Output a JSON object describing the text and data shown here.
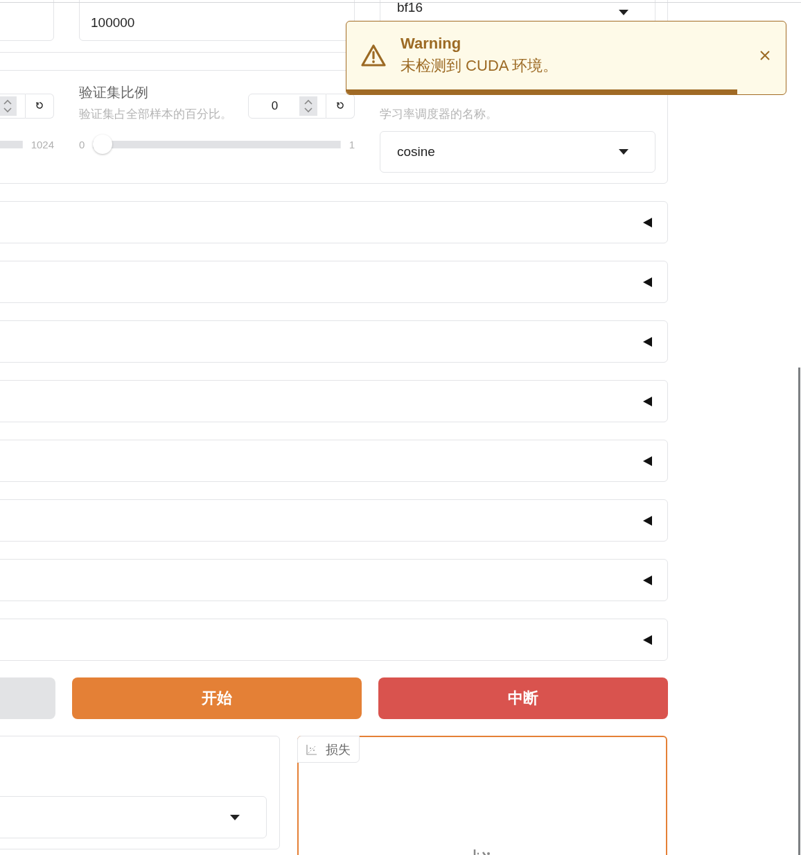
{
  "top_row": {
    "fields": [
      {
        "kind": "text",
        "value": "100000"
      },
      {
        "kind": "dropdown",
        "value": "bf16"
      }
    ]
  },
  "settings_card": {
    "columns": [
      {
        "kind": "number_slider",
        "slider_max": "1024"
      },
      {
        "kind": "number_slider",
        "label": "验证集比例",
        "description": "验证集占全部样本的百分比。",
        "value": "0",
        "slider_min": "0",
        "slider_max": "1",
        "level": 0
      },
      {
        "kind": "dropdown",
        "description": "学习率调度器的名称。",
        "value": "cosine"
      }
    ]
  },
  "accordions": [
    {
      "expanded": false
    },
    {
      "expanded": false
    },
    {
      "expanded": false
    },
    {
      "expanded": false
    },
    {
      "expanded": false
    },
    {
      "expanded": false
    },
    {
      "expanded": false
    },
    {
      "expanded": false
    }
  ],
  "buttons": [
    {
      "kind": "secondary"
    },
    {
      "kind": "primary",
      "label": "开始"
    },
    {
      "kind": "stop",
      "label": "中断"
    }
  ],
  "output_panels": [
    {
      "kind": "dropdown_panel"
    },
    {
      "kind": "plot",
      "label": "损失"
    }
  ],
  "toast": {
    "kind": "warning",
    "title": "Warning",
    "message": "未检测到 CUDA 环境。",
    "level": 0.89
  }
}
